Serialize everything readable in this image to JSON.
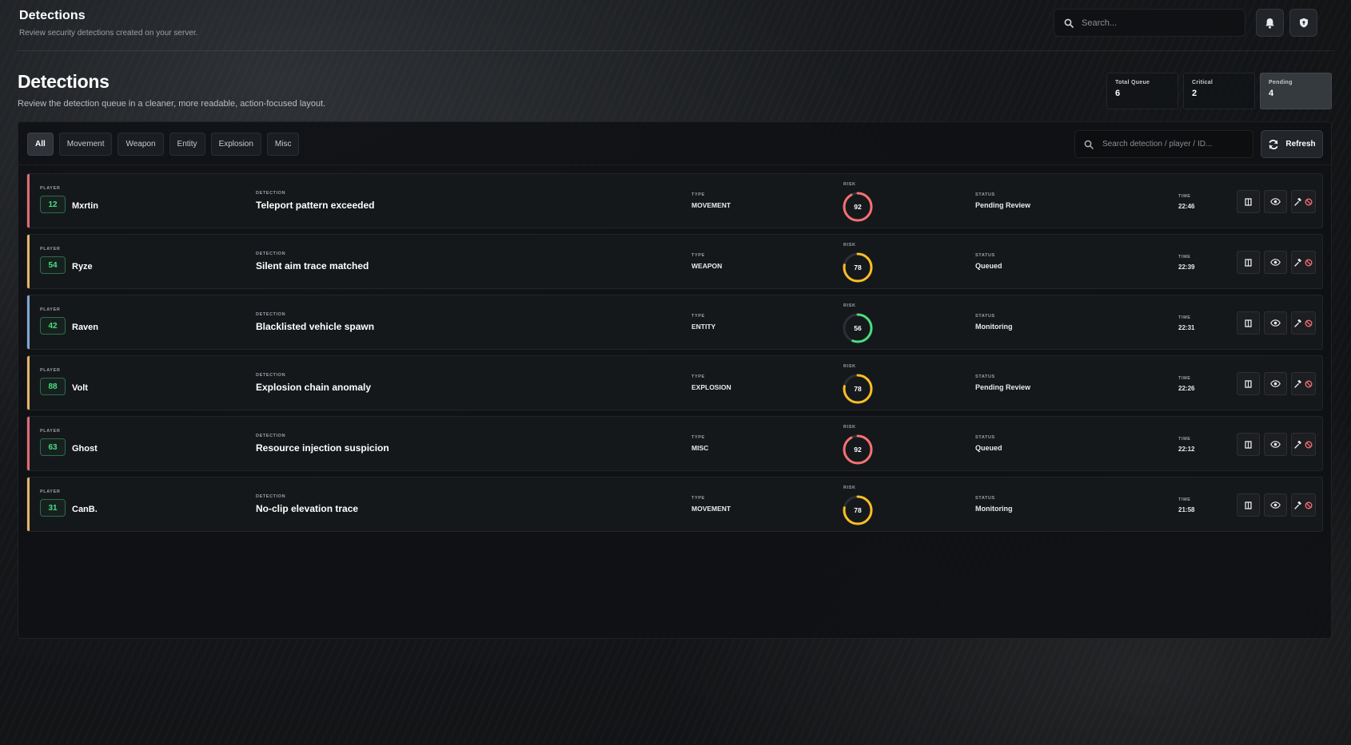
{
  "header": {
    "title": "Detections",
    "subtitle": "Review security detections created on your server.",
    "search_placeholder": "Search..."
  },
  "section": {
    "title": "Detections",
    "subtitle": "Review the detection queue in a cleaner, more readable, action-focused layout."
  },
  "stats": [
    {
      "label": "Total Queue",
      "value": "6"
    },
    {
      "label": "Critical",
      "value": "2"
    },
    {
      "label": "Pending",
      "value": "4"
    }
  ],
  "tabs": [
    "All",
    "Movement",
    "Weapon",
    "Entity",
    "Explosion",
    "Misc"
  ],
  "toolbar": {
    "search_placeholder": "Search detection / player / ID...",
    "refresh_label": "Refresh"
  },
  "captions": {
    "player": "PLAYER",
    "detection": "DETECTION",
    "type": "TYPE",
    "risk": "RISK",
    "status": "STATUS",
    "time": "TIME"
  },
  "colors": {
    "critical": "#e06c75",
    "warning": "#e5b567",
    "info": "#7fa7d4",
    "ring_high": "#f87171",
    "ring_mid": "#fbbf24",
    "ring_low": "#4ade80",
    "player_id": "#4ade80"
  },
  "rows": [
    {
      "player_id": "12",
      "player": "Mxrtin",
      "detection": "Teleport pattern exceeded",
      "type": "MOVEMENT",
      "risk": "92",
      "status": "Pending Review",
      "time": "22:46",
      "accent": "#e06c75",
      "ring": "#f87171"
    },
    {
      "player_id": "54",
      "player": "Ryze",
      "detection": "Silent aim trace matched",
      "type": "WEAPON",
      "risk": "78",
      "status": "Queued",
      "time": "22:39",
      "accent": "#e5b567",
      "ring": "#fbbf24"
    },
    {
      "player_id": "42",
      "player": "Raven",
      "detection": "Blacklisted vehicle spawn",
      "type": "ENTITY",
      "risk": "56",
      "status": "Monitoring",
      "time": "22:31",
      "accent": "#7fa7d4",
      "ring": "#4ade80"
    },
    {
      "player_id": "88",
      "player": "Volt",
      "detection": "Explosion chain anomaly",
      "type": "EXPLOSION",
      "risk": "78",
      "status": "Pending Review",
      "time": "22:26",
      "accent": "#e5b567",
      "ring": "#fbbf24"
    },
    {
      "player_id": "63",
      "player": "Ghost",
      "detection": "Resource injection suspicion",
      "type": "MISC",
      "risk": "92",
      "status": "Queued",
      "time": "22:12",
      "accent": "#e06c75",
      "ring": "#f87171"
    },
    {
      "player_id": "31",
      "player": "CanB.",
      "detection": "No-clip elevation trace",
      "type": "MOVEMENT",
      "risk": "78",
      "status": "Monitoring",
      "time": "21:58",
      "accent": "#e5b567",
      "ring": "#fbbf24"
    }
  ]
}
